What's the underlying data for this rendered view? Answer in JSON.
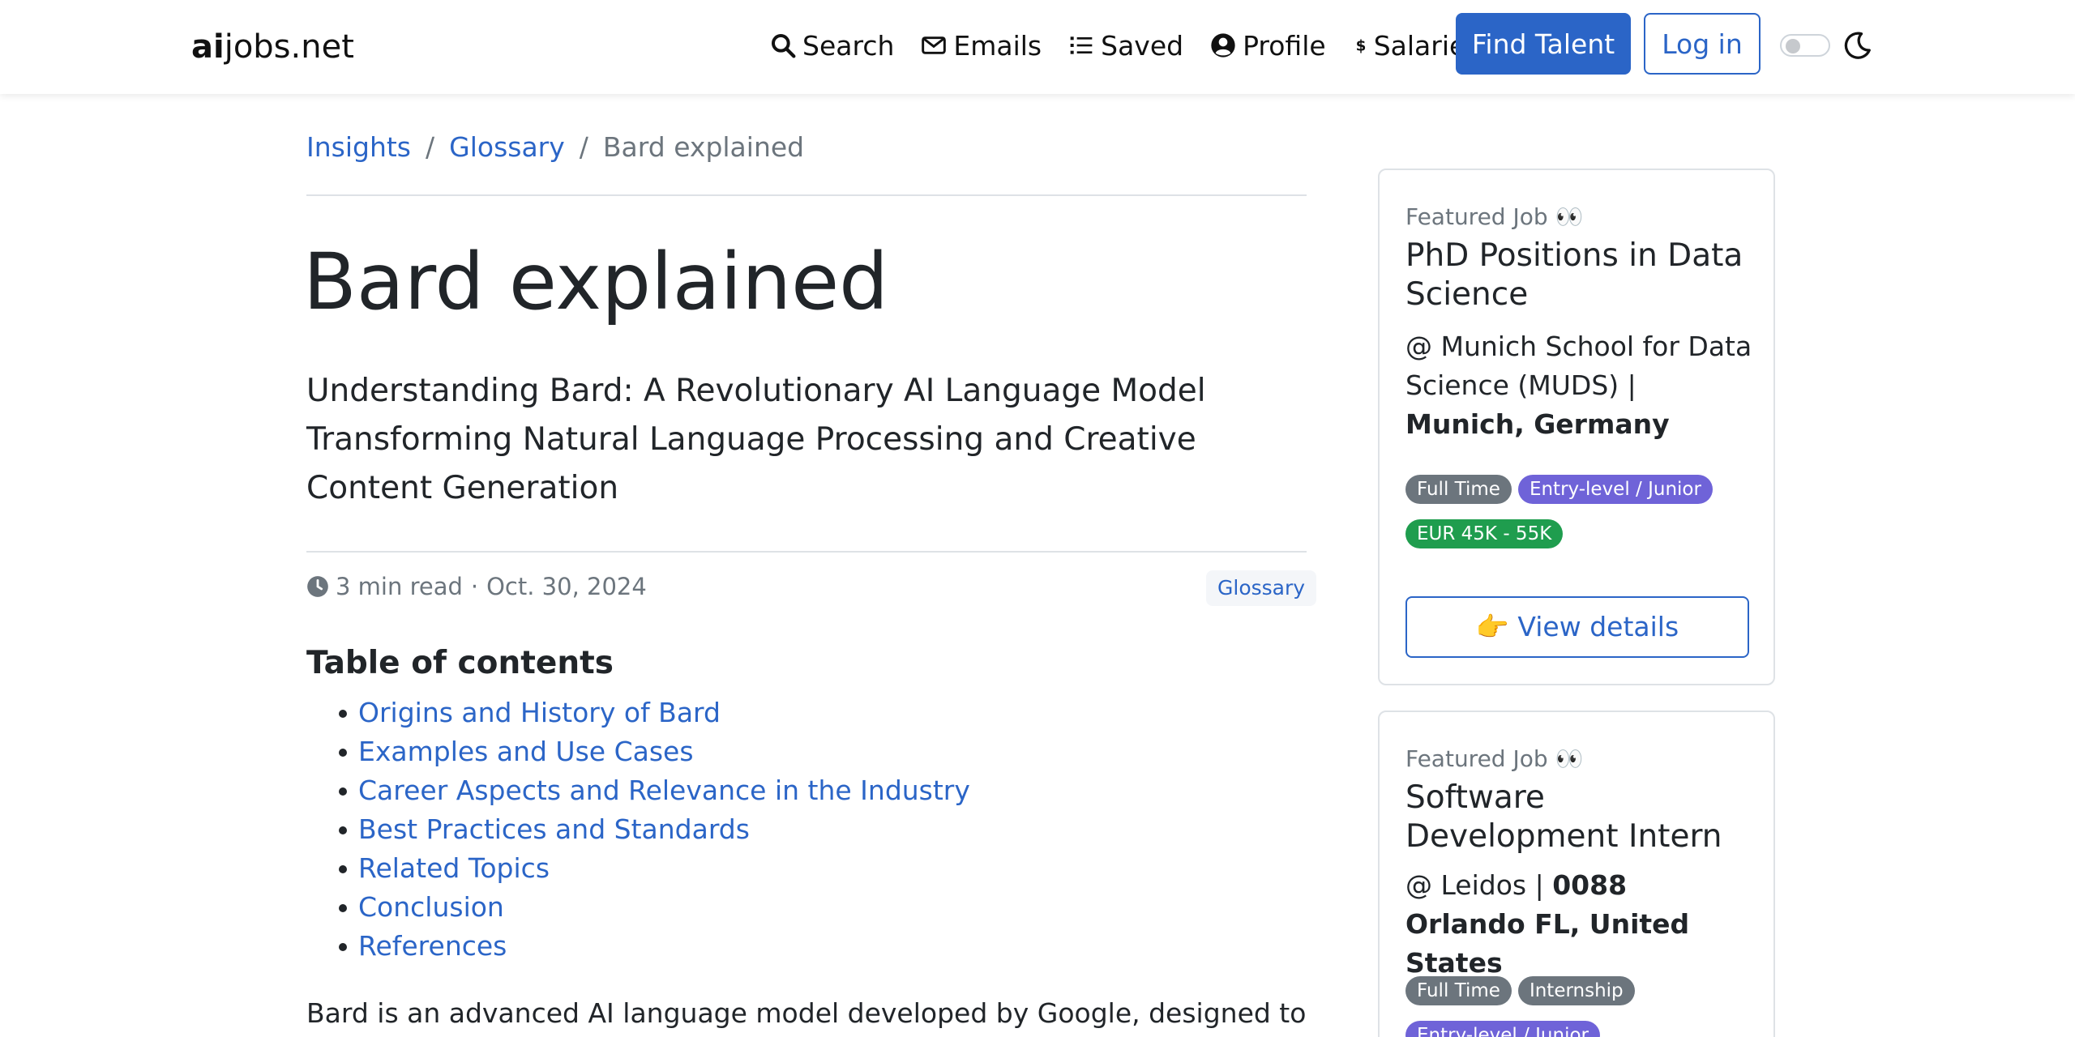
{
  "nav": {
    "brand_bold": "ai",
    "brand_rest": "jobs.net",
    "links": [
      {
        "label": "Search",
        "icon": "search-icon"
      },
      {
        "label": "Emails",
        "icon": "envelope-icon"
      },
      {
        "label": "Saved",
        "icon": "list-icon"
      },
      {
        "label": "Profile",
        "icon": "user-circle-icon"
      },
      {
        "label": "Salaries",
        "icon": "dollar-icon"
      }
    ],
    "find_talent": "Find Talent",
    "login": "Log in"
  },
  "breadcrumb": {
    "items": [
      "Insights",
      "Glossary"
    ],
    "separator": "/",
    "current": "Bard explained"
  },
  "article": {
    "title": "Bard explained",
    "subtitle": "Understanding Bard: A Revolutionary AI Language Model Transforming Natural Language Processing and Creative Content Generation",
    "read_time": "3 min read",
    "dot": "·",
    "date": "Oct. 30, 2024",
    "tag": "Glossary",
    "toc_title": "Table of contents",
    "toc": [
      "Origins and History of Bard",
      "Examples and Use Cases",
      "Career Aspects and Relevance in the Industry",
      "Best Practices and Standards",
      "Related Topics",
      "Conclusion",
      "References"
    ],
    "intro": "Bard is an advanced AI language model developed by Google, designed to"
  },
  "featured": [
    {
      "eyebrow": "Featured Job 👀",
      "title": "PhD Positions in Data Science",
      "company": "@ Munich School for Data Science (MUDS) |",
      "location": "Munich, Germany",
      "badges": [
        {
          "label": "Full Time",
          "color": "gray"
        },
        {
          "label": "Entry-level / Junior",
          "color": "purple"
        },
        {
          "label": "EUR 45K - 55K",
          "color": "green"
        }
      ],
      "button": "👉 View details"
    },
    {
      "eyebrow": "Featured Job 👀",
      "title": "Software Development Intern",
      "company": "@ Leidos |",
      "location": "0088 Orlando FL, United States",
      "badges": [
        {
          "label": "Full Time",
          "color": "gray"
        },
        {
          "label": "Internship",
          "color": "gray"
        },
        {
          "label": "Entry-level / Junior",
          "color": "purple"
        }
      ]
    }
  ],
  "colors": {
    "accent": "#2b65c7",
    "muted": "#6c757d",
    "badge_gray": "#6c757d",
    "badge_purple": "#6f63d8",
    "badge_green": "#1f9d4e"
  }
}
